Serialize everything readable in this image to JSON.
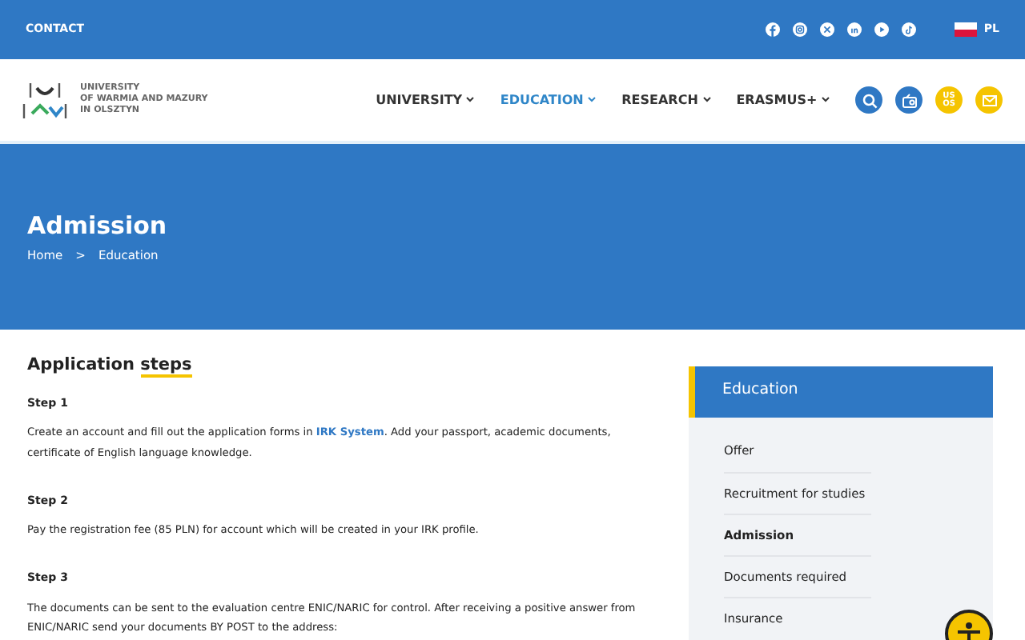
{
  "topbar": {
    "contact": "CONTACT",
    "social": [
      {
        "kind": "facebook"
      },
      {
        "kind": "instagram"
      },
      {
        "kind": "x"
      },
      {
        "kind": "linkedin"
      },
      {
        "kind": "youtube"
      },
      {
        "kind": "tiktok"
      }
    ],
    "language": "PL"
  },
  "header": {
    "logo_lines": [
      "UNIVERSITY",
      "OF WARMIA AND MAZURY",
      "IN OLSZTYN"
    ],
    "nav": [
      {
        "label": "UNIVERSITY",
        "selected": false
      },
      {
        "label": "EDUCATION",
        "selected": true
      },
      {
        "label": "RESEARCH",
        "selected": false
      },
      {
        "label": "ERASMUS+",
        "selected": false
      }
    ],
    "tools": [
      {
        "kind": "search",
        "color": "#2f78c4"
      },
      {
        "kind": "radio",
        "color": "#2f78c4"
      },
      {
        "kind": "usos",
        "label": "USOS",
        "color": "#f5c400"
      },
      {
        "kind": "mail",
        "color": "#f5c400"
      }
    ]
  },
  "hero": {
    "title": "Admission",
    "breadcrumb": [
      "Home",
      "Education"
    ],
    "separator": ">"
  },
  "content": {
    "heading": "Application **steps**",
    "steps": [
      {
        "title": "Step 1",
        "text": "Create an account and fill out the application forms in",
        "link": "IRK System",
        "text_after": ". Add your passport, academic documents, certificate of English language knowledge."
      },
      {
        "title": "Step 2",
        "text": "Pay the registration fee (85 PLN) for account which will be created in your IRK profile."
      },
      {
        "title": "Step 3",
        "text": "The documents can be sent to the evaluation centre ENIC/NARIC for control. After receiving a positive answer from ENIC/NARIC send your documents BY POST to the address:"
      }
    ]
  },
  "sidebar": {
    "title": "Education",
    "items": [
      {
        "label": "Offer",
        "selected": false
      },
      {
        "label": "Recruitment for studies",
        "selected": false
      },
      {
        "label": "Admission",
        "selected": true
      },
      {
        "label": "Documents required",
        "selected": false
      },
      {
        "label": "Insurance",
        "selected": false
      }
    ]
  }
}
